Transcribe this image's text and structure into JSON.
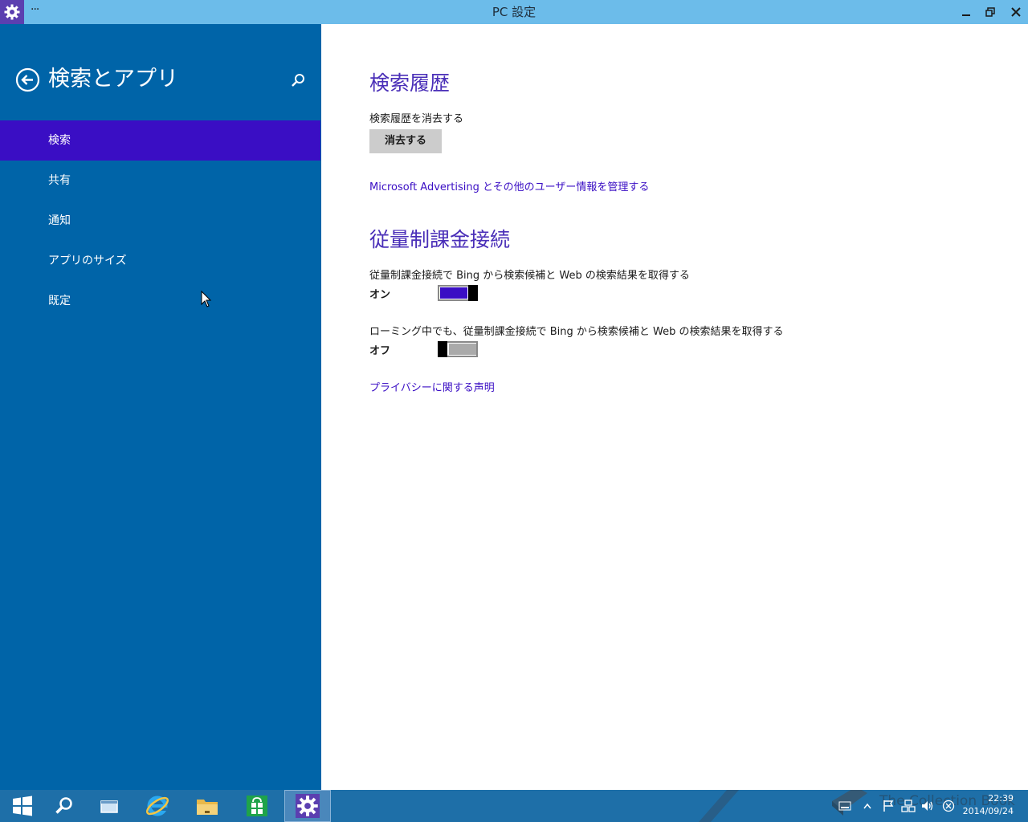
{
  "window": {
    "title": "PC 設定",
    "menu_dots": "···",
    "accent_color": "#6cbcea"
  },
  "sidebar": {
    "title": "検索とアプリ",
    "background": "#0064a8",
    "selected_color": "#3a0ec4",
    "items": [
      {
        "label": "検索",
        "selected": true
      },
      {
        "label": "共有",
        "selected": false
      },
      {
        "label": "通知",
        "selected": false
      },
      {
        "label": "アプリのサイズ",
        "selected": false
      },
      {
        "label": "既定",
        "selected": false
      }
    ]
  },
  "main": {
    "search_history": {
      "heading": "検索履歴",
      "clear_label": "検索履歴を消去する",
      "clear_button": "消去する",
      "advertising_link": "Microsoft Advertising とその他のユーザー情報を管理する"
    },
    "metered": {
      "heading": "従量制課金接続",
      "setting1_label": "従量制課金接続で Bing から検索候補と Web の検索結果を取得する",
      "setting1_state": "オン",
      "setting1_on": true,
      "setting2_label": "ローミング中でも、従量制課金接続で Bing から検索候補と Web の検索結果を取得する",
      "setting2_state": "オフ",
      "setting2_on": false
    },
    "privacy_link": "プライバシーに関する声明"
  },
  "taskbar": {
    "items": [
      "start-icon",
      "search-icon",
      "task-view-icon",
      "internet-explorer-icon",
      "file-explorer-icon",
      "store-icon",
      "settings-icon"
    ],
    "active_item": "settings-icon",
    "clock_time": "22:39",
    "clock_date": "2014/09/24",
    "watermark": "The Collection Book"
  }
}
